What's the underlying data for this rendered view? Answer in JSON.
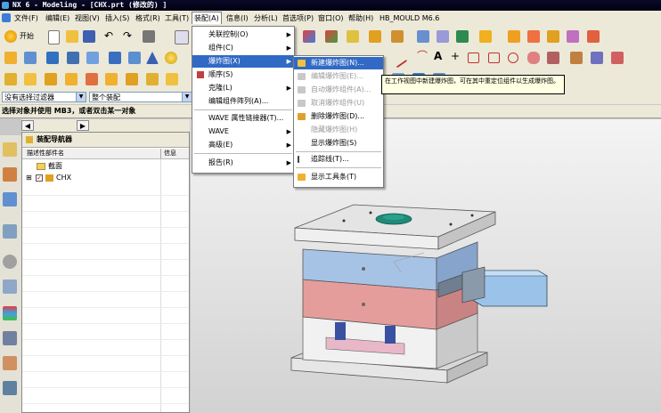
{
  "window": {
    "title": "NX 6 - Modeling - [CHX.prt  (修改的) ]"
  },
  "menubar": [
    {
      "label": "文件(F)"
    },
    {
      "label": "编辑(E)"
    },
    {
      "label": "视图(V)"
    },
    {
      "label": "插入(S)"
    },
    {
      "label": "格式(R)"
    },
    {
      "label": "工具(T)"
    },
    {
      "label": "装配(A)"
    },
    {
      "label": "信息(I)"
    },
    {
      "label": "分析(L)"
    },
    {
      "label": "首选项(P)"
    },
    {
      "label": "窗口(O)"
    },
    {
      "label": "帮助(H)"
    },
    {
      "label": "HB_MOULD M6.6"
    }
  ],
  "toolbar": {
    "start_label": "开始"
  },
  "filter": {
    "selection_filter": "没有选择过滤器",
    "assembly_scope": "整个装配"
  },
  "status_line": "选择对象并使用 MB3，或者双击某一对象",
  "assembly_navigator": {
    "title": "装配导航器",
    "columns": [
      "描述性部件名",
      "信息"
    ],
    "rows": [
      {
        "label": "截面"
      },
      {
        "label": "CHX"
      }
    ]
  },
  "assembly_menu": [
    {
      "label": "关联控制(O)"
    },
    {
      "label": "组件(C)"
    },
    {
      "label": "爆炸图(X)"
    },
    {
      "label": "顺序(S)"
    },
    {
      "label": "克隆(L)"
    },
    {
      "label": "编辑组件阵列(A)..."
    },
    {
      "label": "WAVE 属性链接器(T)..."
    },
    {
      "label": "WAVE"
    },
    {
      "label": "高级(E)"
    },
    {
      "label": "报告(R)"
    }
  ],
  "exploded_view_submenu": [
    {
      "label": "新建爆炸图(N)..."
    },
    {
      "label": "编辑爆炸图(E)..."
    },
    {
      "label": "自动爆炸组件(A)..."
    },
    {
      "label": "取消爆炸组件(U)"
    },
    {
      "label": "删除爆炸图(D)..."
    },
    {
      "label": "隐藏爆炸图(H)"
    },
    {
      "label": "显示爆炸图(S)"
    },
    {
      "label": "追踪线(T)..."
    },
    {
      "label": "显示工具条(T)"
    }
  ],
  "tooltip": "在工作视图中新建爆炸图，可在其中重定位组件以生成爆炸图。",
  "colors": {
    "menu_highlight": "#316ac5",
    "mold_blue": "#a7c4e6",
    "mold_red": "#e09b99",
    "mold_green": "#1e8a78"
  }
}
